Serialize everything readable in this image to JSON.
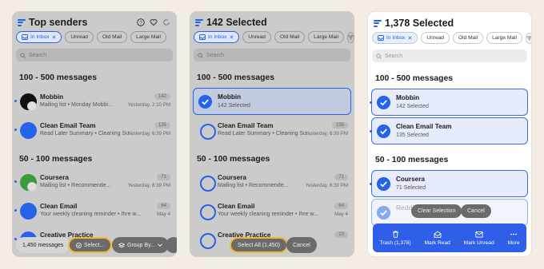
{
  "chips": {
    "inbox": "In Inbox",
    "unread": "Unread",
    "old_mail": "Old Mail",
    "large_mail": "Large Mail"
  },
  "search_placeholder": "Search",
  "sections": {
    "s1": "100 - 500 messages",
    "s2": "50 - 100 messages"
  },
  "panel1": {
    "title": "Top senders",
    "rows": [
      {
        "name": "Mobbin",
        "sub": "Mailing list • Monday Mobbi...",
        "count": "142",
        "date": "Yesterday, 2:10 PM"
      },
      {
        "name": "Clean Email Team",
        "sub": "Read Later Summary • Cleaning Su...",
        "count": "135",
        "date": "Yesterday, 6:39 PM"
      },
      {
        "name": "Coursera",
        "sub": "Mailing list • Recommende...",
        "count": "71",
        "date": "Yesterday, 6:39 PM"
      },
      {
        "name": "Clean Email",
        "sub": "Your weekly cleaning reminder • Ihre w...",
        "count": "64",
        "date": "May 4"
      },
      {
        "name": "Creative Practice",
        "sub": "",
        "count": "",
        "date": ""
      }
    ],
    "bottom": {
      "messages": "1,450 messages",
      "select": "Select...",
      "group_by": "Group By..."
    }
  },
  "panel2": {
    "title": "142 Selected",
    "rows": [
      {
        "name": "Mobbin",
        "sub": "142 Selected"
      },
      {
        "name": "Clean Email Team",
        "sub": "Read Later Summary • Cleaning Su...",
        "count": "135",
        "date": "Yesterday, 6:39 PM"
      },
      {
        "name": "Coursera",
        "sub": "Mailing list • Recommende...",
        "count": "71",
        "date": "Yesterday, 6:39 PM"
      },
      {
        "name": "Clean Email",
        "sub": "Your weekly cleaning reminder • Ihre w...",
        "count": "64",
        "date": "May 4"
      },
      {
        "name": "Creative Practice",
        "sub": "",
        "count": "23",
        "date": ""
      }
    ],
    "bottom": {
      "select_all": "Select All (1,450)",
      "cancel": "Cancel"
    }
  },
  "panel3": {
    "title": "1,378 Selected",
    "rows": [
      {
        "name": "Mobbin",
        "sub": "142 Selected"
      },
      {
        "name": "Clean Email Team",
        "sub": "135 Selected"
      },
      {
        "name": "Coursera",
        "sub": "71 Selected"
      },
      {
        "name": "Reddi...",
        "sub": ""
      }
    ],
    "floating": {
      "clear": "Clear Selection",
      "cancel": "Cancel"
    },
    "actions": {
      "trash": "Trash (1,378)",
      "mark_read": "Mark Read",
      "mark_unread": "Mark Unread",
      "more": "More"
    }
  }
}
